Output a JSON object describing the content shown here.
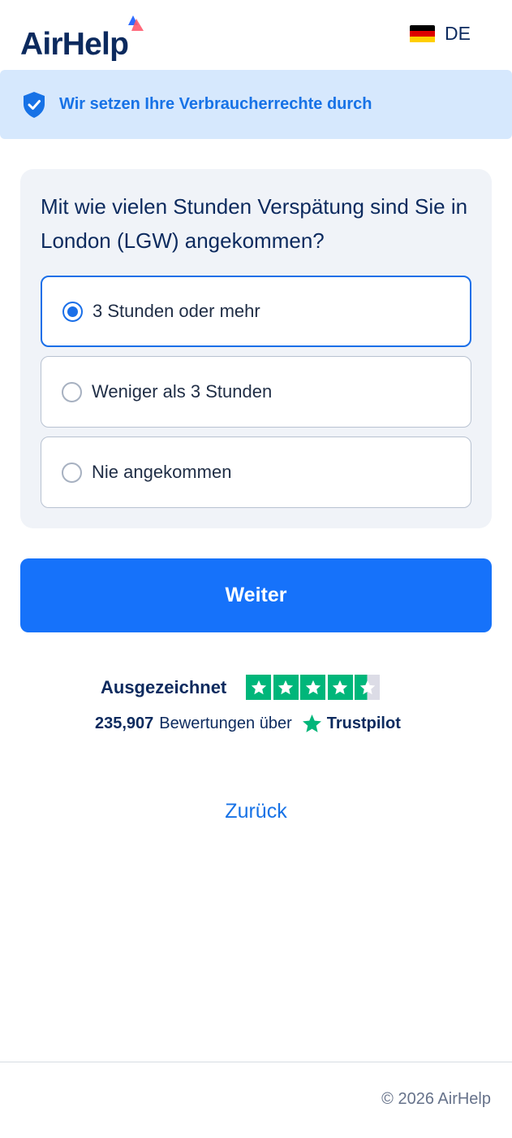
{
  "header": {
    "logo_text": "AirHelp",
    "language_code": "DE",
    "flag_colors": [
      "#000000",
      "#dd0000",
      "#ffce00"
    ]
  },
  "banner": {
    "icon": "shield-check-icon",
    "text": "Wir setzen Ihre Verbraucherrechte durch"
  },
  "question": {
    "title": "Mit wie vielen Stunden Verspätung sind Sie in London (LGW) angekommen?",
    "options": [
      {
        "label": "3 Stunden oder mehr",
        "selected": true
      },
      {
        "label": "Weniger als 3 Stunden",
        "selected": false
      },
      {
        "label": "Nie angekommen",
        "selected": false
      }
    ]
  },
  "cta": {
    "label": "Weiter"
  },
  "trustpilot": {
    "rating_label": "Ausgezeichnet",
    "stars": 4.5,
    "review_count": "235,907",
    "reviews_text": "Bewertungen über",
    "brand": "Trustpilot",
    "color": "#00b67a"
  },
  "back_link": "Zurück",
  "footer": {
    "copyright": "© 2026 AirHelp"
  },
  "colors": {
    "primary": "#1672fa",
    "navy": "#0c2a5e",
    "banner_bg": "#d6e8fd",
    "card_bg": "#f0f3f8"
  }
}
